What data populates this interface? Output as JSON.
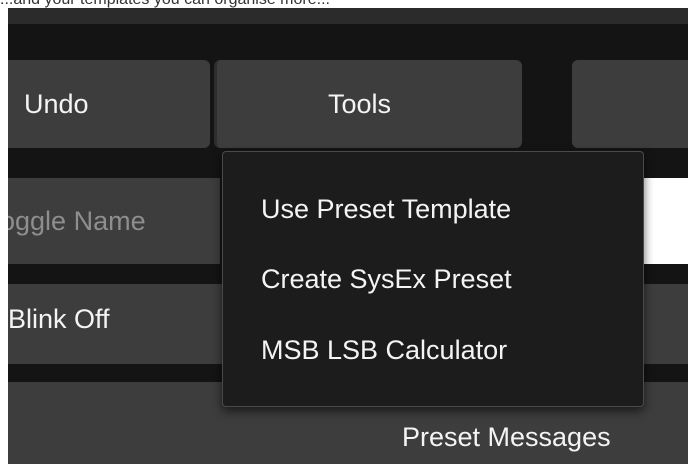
{
  "top_strip": {
    "text": "...and your templates you can organise more..."
  },
  "toolbar": {
    "undo_label": "Undo",
    "tools_label": "Tools",
    "right_label": ""
  },
  "rows": {
    "toggle_name_label": "oggle Name",
    "blink_off_label": "Blink Off",
    "preset_messages_label": "Preset Messages"
  },
  "tools_menu": {
    "items": [
      {
        "label": "Use Preset Template"
      },
      {
        "label": "Create SysEx Preset"
      },
      {
        "label": "MSB LSB Calculator"
      }
    ]
  }
}
